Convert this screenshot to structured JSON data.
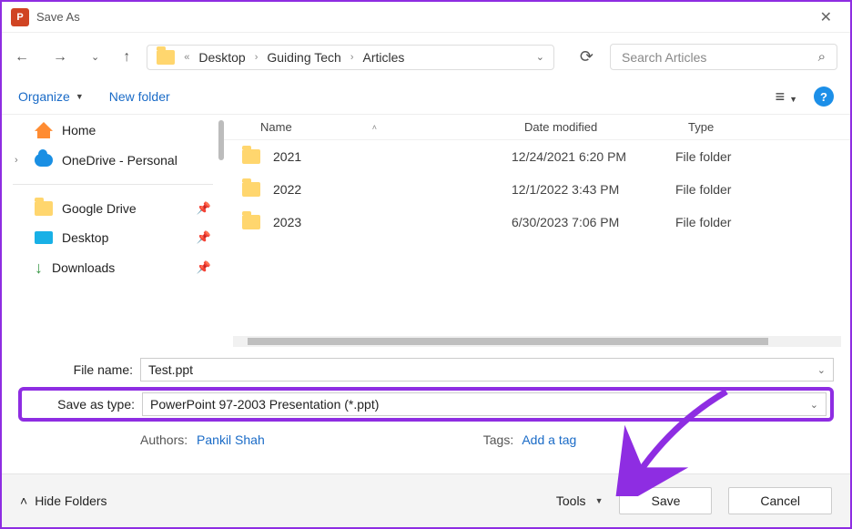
{
  "titlebar": {
    "title": "Save As"
  },
  "nav": {
    "breadcrumbs": [
      "Desktop",
      "Guiding Tech",
      "Articles"
    ],
    "search_placeholder": "Search Articles"
  },
  "toolbar": {
    "organize": "Organize",
    "new_folder": "New folder"
  },
  "sidebar": {
    "items": [
      {
        "label": "Home",
        "icon": "home"
      },
      {
        "label": "OneDrive - Personal",
        "icon": "cloud",
        "expandable": true
      },
      {
        "label": "Google Drive",
        "icon": "folder",
        "pinned": true
      },
      {
        "label": "Desktop",
        "icon": "desktop",
        "pinned": true
      },
      {
        "label": "Downloads",
        "icon": "download",
        "pinned": true
      }
    ]
  },
  "columns": {
    "name": "Name",
    "date": "Date modified",
    "type": "Type"
  },
  "rows": [
    {
      "name": "2021",
      "date": "12/24/2021 6:20 PM",
      "type": "File folder"
    },
    {
      "name": "2022",
      "date": "12/1/2022 3:43 PM",
      "type": "File folder"
    },
    {
      "name": "2023",
      "date": "6/30/2023 7:06 PM",
      "type": "File folder"
    }
  ],
  "fields": {
    "filename_label": "File name:",
    "filename_value": "Test.ppt",
    "savetype_label": "Save as type:",
    "savetype_value": "PowerPoint 97-2003 Presentation (*.ppt)"
  },
  "meta": {
    "authors_label": "Authors:",
    "authors_value": "Pankil Shah",
    "tags_label": "Tags:",
    "tags_value": "Add a tag"
  },
  "footer": {
    "hide_folders": "Hide Folders",
    "tools": "Tools",
    "save": "Save",
    "cancel": "Cancel"
  }
}
